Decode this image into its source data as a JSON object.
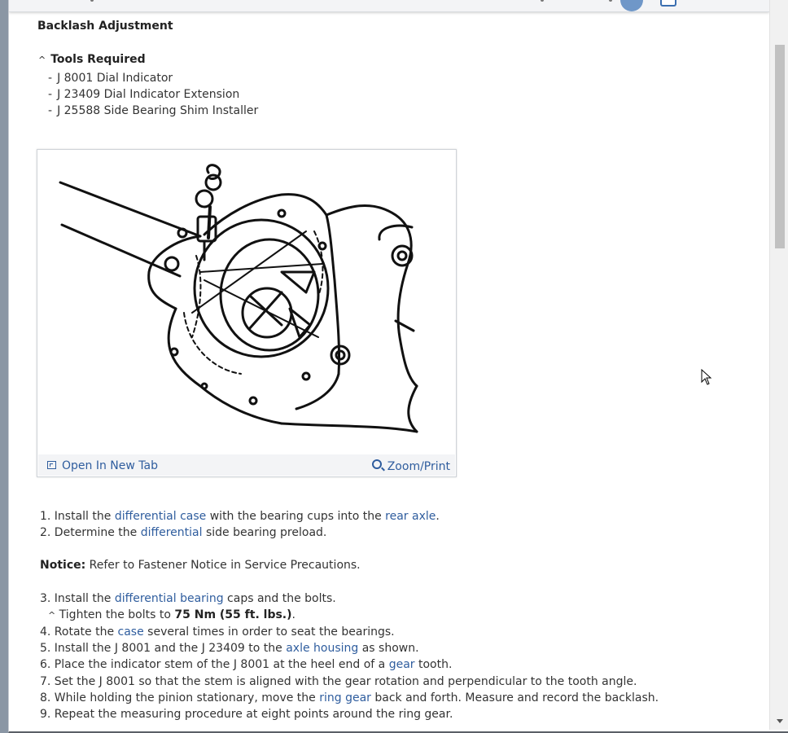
{
  "title": "Backlash Adjustment",
  "tools": {
    "caret": "^",
    "heading": "Tools Required",
    "items": [
      "J 8001 Dial Indicator",
      "J 23409 Dial Indicator Extension",
      "J 25588 Side Bearing Shim Installer"
    ]
  },
  "figure": {
    "open_label": "Open In New Tab",
    "zoom_label": "Zoom/Print"
  },
  "steps": {
    "s1": {
      "a": "1. Install the ",
      "l1": "differential case",
      "b": " with the bearing cups into the ",
      "l2": "rear axle",
      "c": "."
    },
    "s2": {
      "a": "2. Determine the ",
      "l1": "differential",
      "b": " side bearing preload."
    },
    "notice": {
      "label": "Notice:",
      "text": " Refer to Fastener Notice in Service Precautions."
    },
    "s3": {
      "a": "3. Install the ",
      "l1": "differential bearing",
      "b": " caps and the bolts."
    },
    "s3sub": {
      "caret": "^",
      "a": " Tighten the bolts to ",
      "bold": "75 Nm (55 ft. lbs.)",
      "b": "."
    },
    "s4": {
      "a": "4. Rotate the ",
      "l1": "case",
      "b": " several times in order to seat the bearings."
    },
    "s5": {
      "a": "5. Install the J 8001 and the J 23409 to the ",
      "l1": "axle housing",
      "b": " as shown."
    },
    "s6": {
      "a": "6. Place the indicator stem of the J 8001 at the heel end of a ",
      "l1": "gear",
      "b": " tooth."
    },
    "s7": {
      "a": "7. Set the J 8001 so that the stem is aligned with the gear rotation and perpendicular to the tooth angle."
    },
    "s8": {
      "a": "8. While holding the pinion stationary, move the ",
      "l1": "ring gear",
      "b": " back and forth. Measure and record the backlash."
    },
    "s9": {
      "a": "9. Repeat the measuring procedure at eight points around the ring gear."
    }
  },
  "colors": {
    "link": "#2f5d9e",
    "text": "#333333"
  }
}
